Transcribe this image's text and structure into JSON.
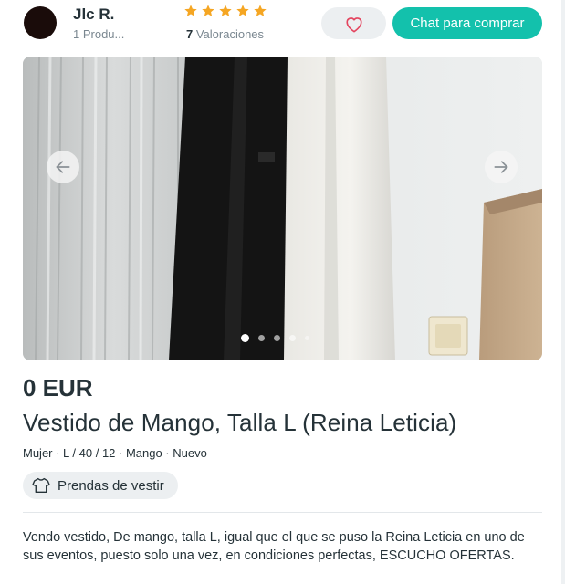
{
  "seller": {
    "name": "Jlc R.",
    "products": "1 Produ...",
    "rating_count": "7",
    "rating_label": " Valoraciones",
    "stars": 5
  },
  "actions": {
    "chat_label": "Chat para comprar",
    "favorite_icon": "heart-icon"
  },
  "carousel": {
    "prev_icon": "arrow-left-icon",
    "next_icon": "arrow-right-icon",
    "current_index": 1,
    "dot_count": 5
  },
  "product": {
    "price": "0 EUR",
    "title": "Vestido de Mango, Talla L (Reina Leticia)",
    "attributes": "Mujer · L / 40 / 12 · Mango · Nuevo",
    "category": "Prendas de vestir",
    "description": "Vendo vestido, De mango, talla L, igual que el que se puso la Reina Leticia en uno de sus eventos, puesto solo una vez, en condiciones perfectas, ESCUCHO OFERTAS."
  },
  "colors": {
    "accent": "#13c1ac",
    "star": "#f5a623",
    "text": "#253238",
    "muted": "#7a8790",
    "chip_bg": "#eceff1"
  }
}
